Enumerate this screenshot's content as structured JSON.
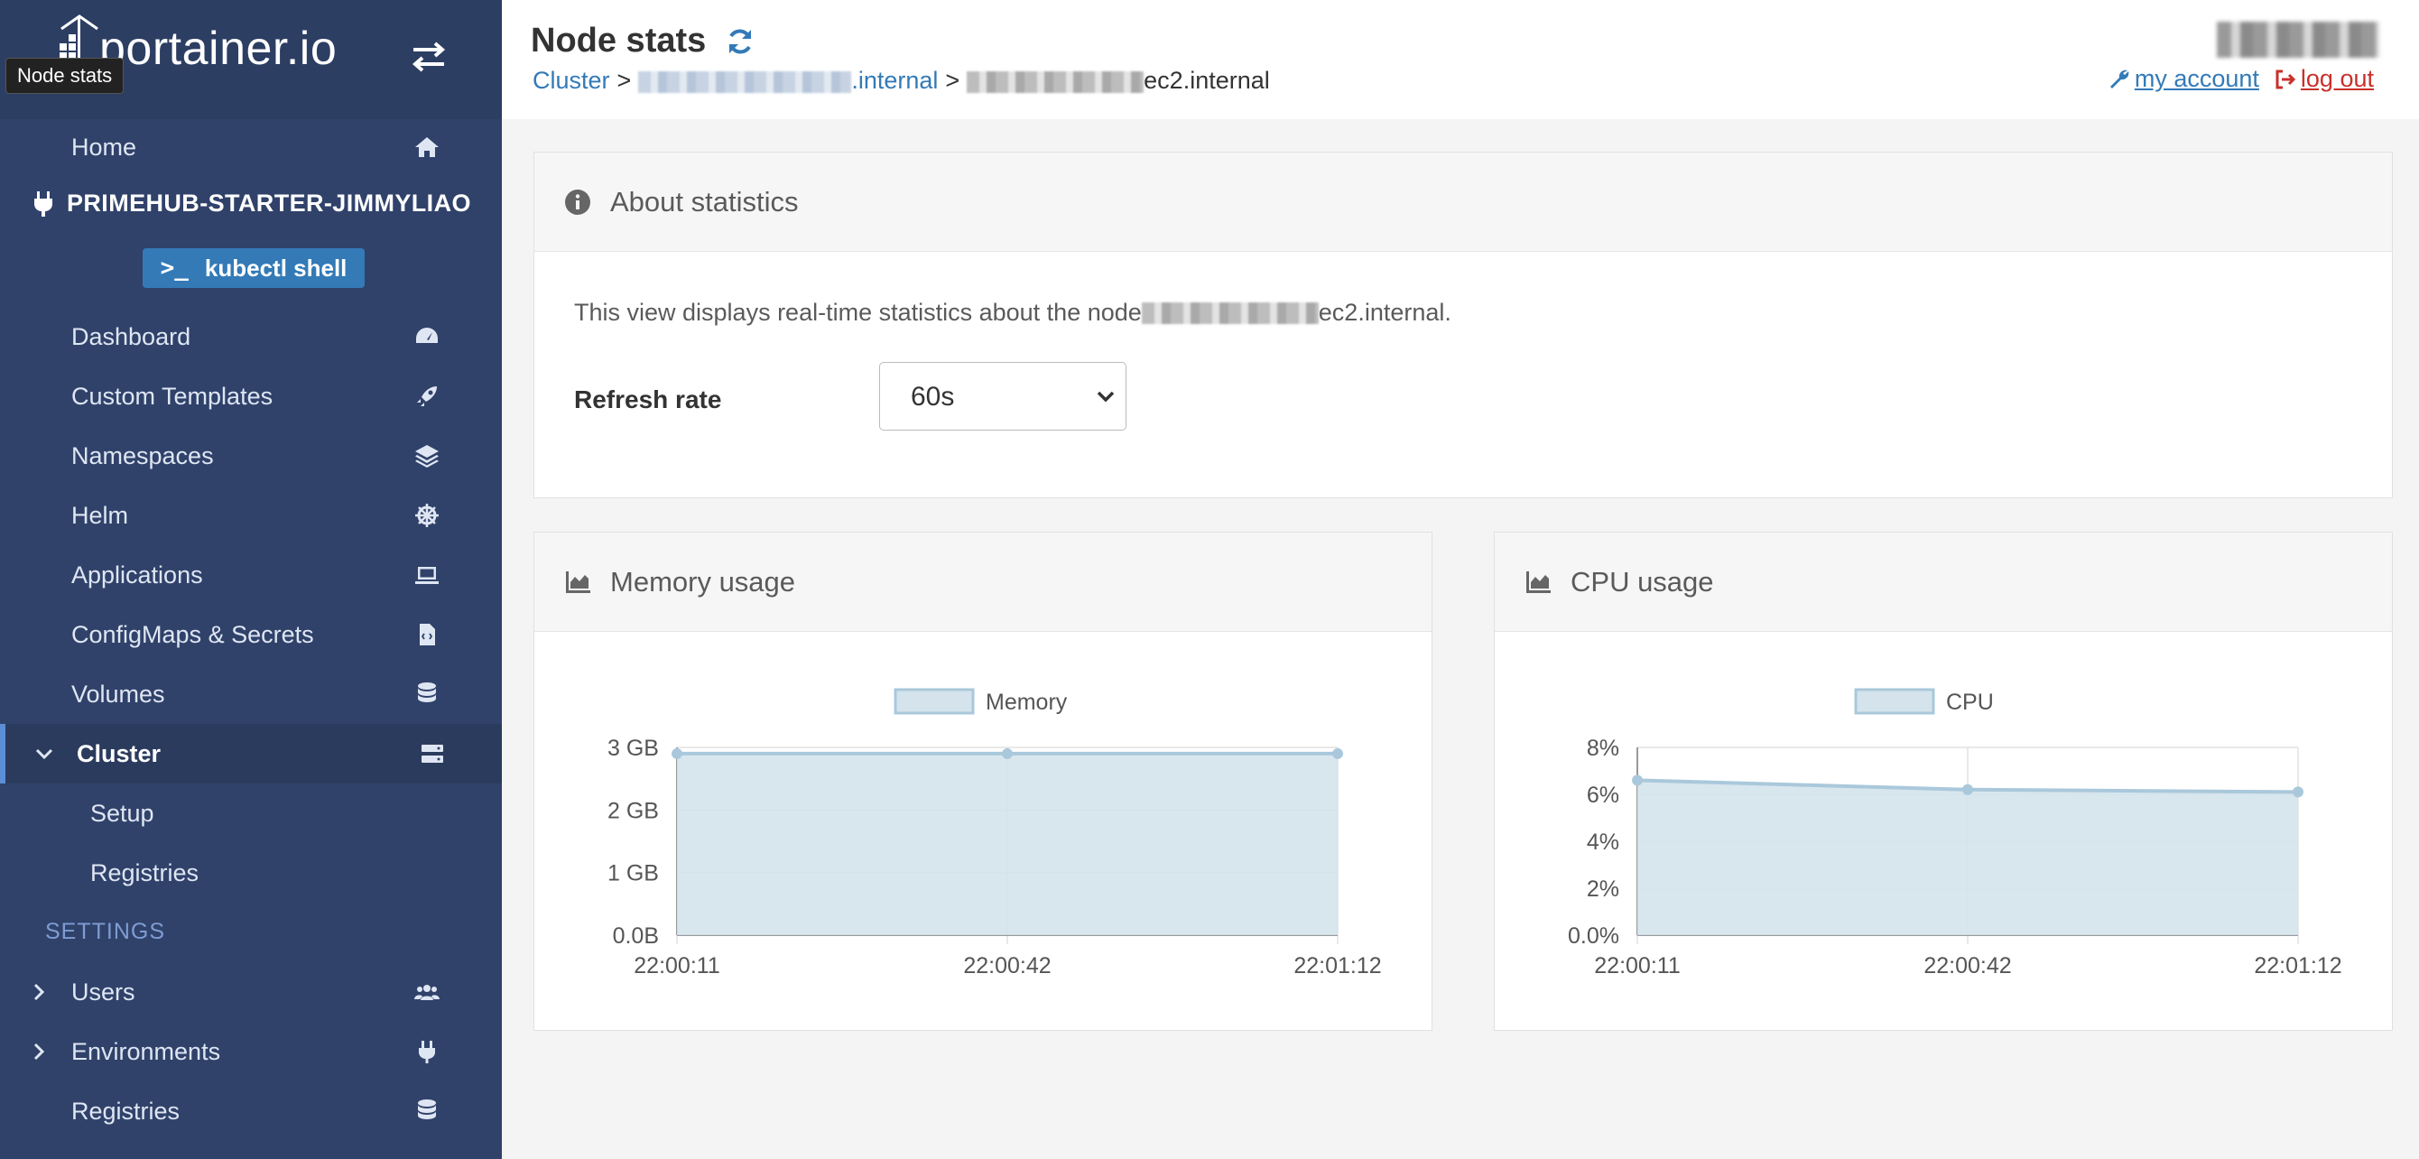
{
  "sidebar": {
    "logo": "portainer.io",
    "tooltip": "Node stats",
    "environment": "PRIMEHUB-STARTER-JIMMYLIAO",
    "kubectl_label": "kubectl shell",
    "kubectl_prompt": ">_",
    "items": [
      {
        "label": "Home",
        "icon": "home-icon"
      },
      {
        "label": "Dashboard",
        "icon": "tachometer-icon"
      },
      {
        "label": "Custom Templates",
        "icon": "rocket-icon"
      },
      {
        "label": "Namespaces",
        "icon": "layers-icon"
      },
      {
        "label": "Helm",
        "icon": "helm-wheel-icon"
      },
      {
        "label": "Applications",
        "icon": "laptop-code-icon"
      },
      {
        "label": "ConfigMaps & Secrets",
        "icon": "file-code-icon"
      },
      {
        "label": "Volumes",
        "icon": "database-icon"
      },
      {
        "label": "Cluster",
        "icon": "server-icon"
      },
      {
        "label": "Setup"
      },
      {
        "label": "Registries"
      }
    ],
    "settings_heading": "SETTINGS",
    "settings_items": [
      {
        "label": "Users",
        "icon": "users-icon"
      },
      {
        "label": "Environments",
        "icon": "plug-icon"
      },
      {
        "label": "Registries",
        "icon": "database-icon"
      }
    ]
  },
  "header": {
    "title": "Node stats",
    "breadcrumb": {
      "root": "Cluster",
      "node_suffix": ".internal",
      "separator": ">",
      "current_suffix": "ec2.internal"
    },
    "my_account": "my account",
    "log_out": "log out"
  },
  "about": {
    "title": "About statistics",
    "text_prefix": "This view displays real-time statistics about the node",
    "text_suffix": "ec2.internal.",
    "refresh_label": "Refresh rate",
    "refresh_value": "60s"
  },
  "panels": {
    "memory_title": "Memory usage",
    "cpu_title": "CPU usage"
  },
  "colors": {
    "sidebar": "#30426a",
    "accent": "#337ab7",
    "danger": "#c9302c",
    "chart_fill": "#d4e3ec",
    "chart_line": "#aac8db"
  },
  "chart_data": [
    {
      "type": "area",
      "title": "Memory usage",
      "x": [
        "22:00:11",
        "22:00:42",
        "22:01:12"
      ],
      "series": [
        {
          "name": "Memory",
          "values": [
            2.9,
            2.9,
            2.9
          ]
        }
      ],
      "ylim": [
        0,
        3
      ],
      "yticks": [
        "0.0B",
        "1 GB",
        "2 GB",
        "3 GB"
      ],
      "ytick_values": [
        0,
        1,
        2,
        3
      ],
      "legend": "top",
      "grid": true
    },
    {
      "type": "area",
      "title": "CPU usage",
      "x": [
        "22:00:11",
        "22:00:42",
        "22:01:12"
      ],
      "series": [
        {
          "name": "CPU",
          "values": [
            6.6,
            6.2,
            6.1
          ]
        }
      ],
      "ylim": [
        0,
        8
      ],
      "yticks": [
        "0.0%",
        "2%",
        "4%",
        "6%",
        "8%"
      ],
      "ytick_values": [
        0,
        2,
        4,
        6,
        8
      ],
      "legend": "top",
      "grid": true
    }
  ]
}
